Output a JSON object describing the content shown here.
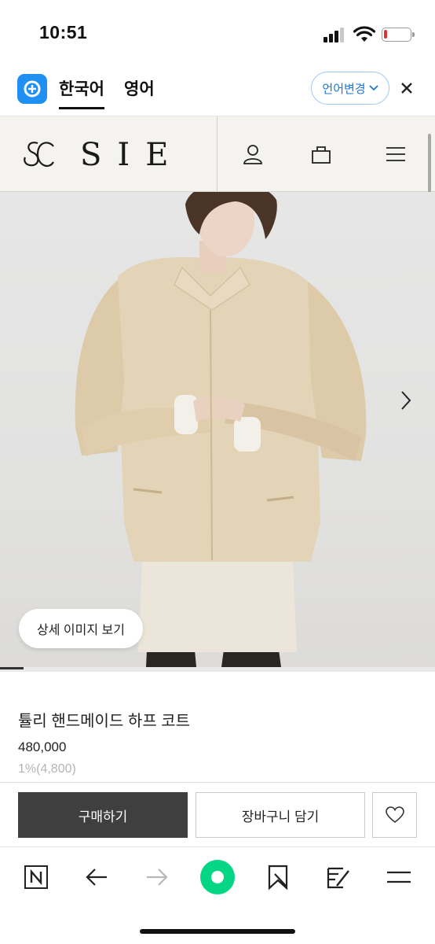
{
  "status_bar": {
    "time": "10:51",
    "battery_level": 0.12,
    "battery_color": "#e2312f"
  },
  "translate_bar": {
    "logo_icon": "translate-app-icon",
    "tabs": [
      {
        "label": "한국어",
        "active": true
      },
      {
        "label": "영어",
        "active": false
      }
    ],
    "change_language_label": "언어변경",
    "accent": "#1a78d6"
  },
  "site_header": {
    "logo_text": "SIE",
    "icons": [
      "user-icon",
      "shopping-bag-icon",
      "menu-icon"
    ]
  },
  "product": {
    "image_alt": "product-photo",
    "detail_image_button": "상세 이미지 보기",
    "image_progress": 0.055,
    "name": "튤리 핸드메이드 하프 코트",
    "price": "480,000",
    "points": "1%(4,800)"
  },
  "actions": {
    "buy_label": "구매하기",
    "cart_label": "장바구니 담기",
    "wishlist_icon": "heart-icon",
    "buy_bg": "#3f3f3f"
  },
  "browser_toolbar": {
    "items": [
      "naver-n-icon",
      "back-arrow-icon",
      "forward-arrow-icon",
      "green-dot-icon",
      "bookmark-icon",
      "share-icon",
      "menu-icon"
    ],
    "green": "#05d686"
  }
}
